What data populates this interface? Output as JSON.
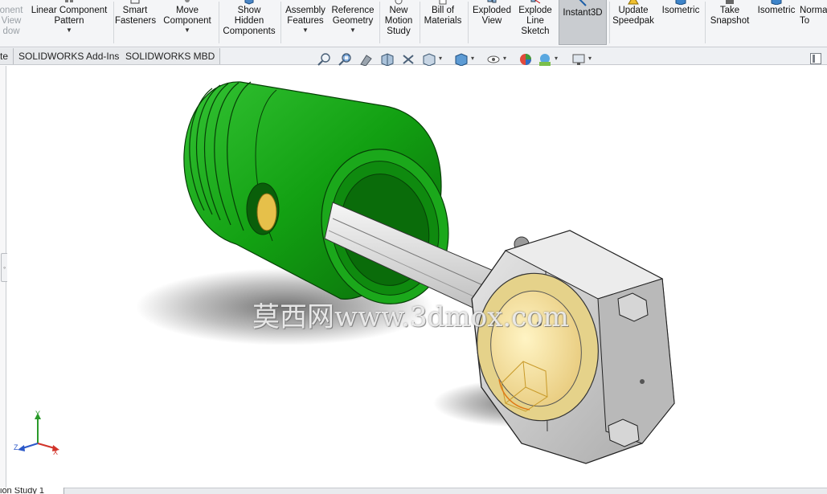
{
  "ribbon": {
    "buttons": [
      {
        "id": "window-partial",
        "label": "onent\nView\ndow",
        "icon": "window-icon",
        "has_dropdown": false
      },
      {
        "id": "linear-pattern",
        "label": "Linear Component\nPattern",
        "icon": "linear-pattern-icon",
        "has_dropdown": true
      },
      {
        "id": "smart-fasteners",
        "label": "Smart\nFasteners",
        "icon": "smart-fasteners-icon",
        "has_dropdown": false
      },
      {
        "id": "move-component",
        "label": "Move\nComponent",
        "icon": "move-component-icon",
        "has_dropdown": true
      },
      {
        "id": "show-hidden",
        "label": "Show\nHidden\nComponents",
        "icon": "show-hidden-icon",
        "has_dropdown": false
      },
      {
        "id": "assembly-features",
        "label": "Assembly\nFeatures",
        "icon": "assembly-features-icon",
        "has_dropdown": true
      },
      {
        "id": "reference-geometry",
        "label": "Reference\nGeometry",
        "icon": "reference-geometry-icon",
        "has_dropdown": true
      },
      {
        "id": "new-motion",
        "label": "New\nMotion\nStudy",
        "icon": "motion-study-icon",
        "has_dropdown": false
      },
      {
        "id": "bill-of-materials",
        "label": "Bill of\nMaterials",
        "icon": "bom-icon",
        "has_dropdown": false
      },
      {
        "id": "exploded-view",
        "label": "Exploded\nView",
        "icon": "exploded-view-icon",
        "has_dropdown": false
      },
      {
        "id": "explode-line-sketch",
        "label": "Explode\nLine\nSketch",
        "icon": "explode-line-icon",
        "has_dropdown": false
      },
      {
        "id": "instant3d",
        "label": "Instant3D",
        "icon": "instant3d-icon",
        "has_dropdown": false,
        "active": true
      },
      {
        "id": "update-speedpak",
        "label": "Update\nSpeedpak",
        "icon": "speedpak-icon",
        "has_dropdown": false
      },
      {
        "id": "isometric-1",
        "label": "Isometric",
        "icon": "isometric-icon",
        "has_dropdown": false
      },
      {
        "id": "take-snapshot",
        "label": "Take\nSnapshot",
        "icon": "camera-icon",
        "has_dropdown": false
      },
      {
        "id": "isometric-2",
        "label": "Isometric",
        "icon": "isometric-icon",
        "has_dropdown": false
      },
      {
        "id": "normal-to",
        "label": "Norma\nTo",
        "icon": "normal-to-icon",
        "has_dropdown": false
      }
    ]
  },
  "tabs": [
    {
      "label": "te",
      "partial": true
    },
    {
      "label": "SOLIDWORKS Add-Ins"
    },
    {
      "label": "SOLIDWORKS MBD"
    }
  ],
  "hud": {
    "icons": [
      "zoom-to-fit-icon",
      "zoom-to-area-icon",
      "previous-view-icon",
      "section-view-icon",
      "dynamic-annotation-icon",
      "view-orientation-icon",
      "display-style-icon",
      "hide-show-items-icon",
      "edit-appearance-icon",
      "apply-scene-icon",
      "view-settings-icon"
    ]
  },
  "viewport": {
    "watermark": "莫西网www.3dmox.com"
  },
  "triad": {
    "x": "X",
    "y": "Y",
    "z": "Z"
  },
  "bottom_tab": {
    "label": "ion Study 1"
  },
  "colors": {
    "piston": "#1aa31a",
    "piston_dark": "#0b5e0b",
    "rod": "#d8d8d8",
    "bearing": "#f1e3a6",
    "cap": "#cfcfcf",
    "ribbon_bg": "#f4f5f7"
  }
}
